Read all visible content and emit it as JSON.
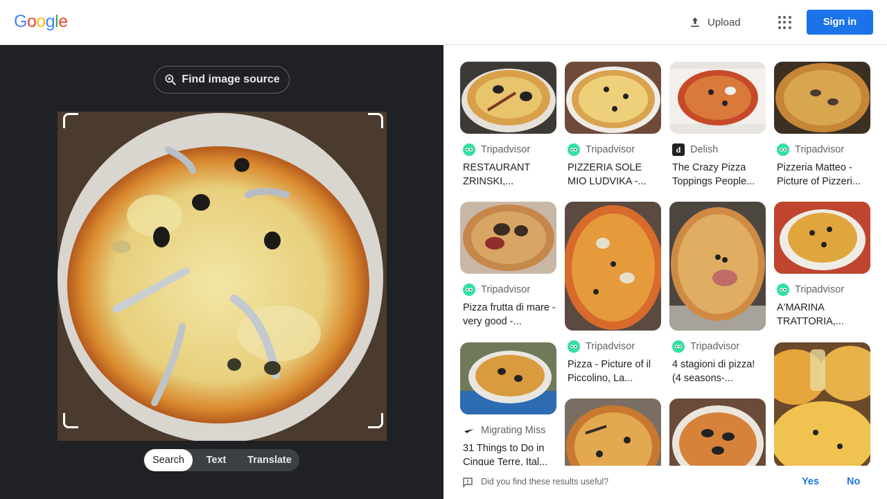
{
  "header": {
    "logo_letters": [
      "G",
      "o",
      "o",
      "g",
      "l",
      "e"
    ],
    "logo_colors": [
      "#4285F4",
      "#EA4335",
      "#FBBC05",
      "#4285F4",
      "#34A853",
      "#EA4335"
    ],
    "upload_label": "Upload",
    "upload_icon": "upload-icon",
    "apps_icon": "apps-grid-icon",
    "signin_label": "Sign in"
  },
  "lens": {
    "find_source_label": "Find image source",
    "find_source_icon": "lens-search-icon",
    "modes": [
      {
        "label": "Search",
        "active": true
      },
      {
        "label": "Text",
        "active": false
      },
      {
        "label": "Translate",
        "active": false
      }
    ]
  },
  "results": [
    {
      "source": "Tripadvisor",
      "icon": "tripadvisor-icon",
      "title": "RESTAURANT ZRINSKI,..."
    },
    {
      "source": "Tripadvisor",
      "icon": "tripadvisor-icon",
      "title": "PIZZERIA SOLE MIO LUDVIKA -..."
    },
    {
      "source": "Delish",
      "icon": "delish-icon",
      "title": "The Crazy Pizza Toppings People..."
    },
    {
      "source": "Tripadvisor",
      "icon": "tripadvisor-icon",
      "title": "Pizzeria Matteo - Picture of Pizzeri..."
    },
    {
      "source": "Tripadvisor",
      "icon": "tripadvisor-icon",
      "title": "Pizza frutta di mare - very good -..."
    },
    {
      "source": "Tripadvisor",
      "icon": "tripadvisor-icon",
      "title": "Pizza - Picture of il Piccolino, La..."
    },
    {
      "source": "Tripadvisor",
      "icon": "tripadvisor-icon",
      "title": "4 stagioni di pizza! (4 seasons-..."
    },
    {
      "source": "Tripadvisor",
      "icon": "tripadvisor-icon",
      "title": "A'MARINA TRATTORIA,..."
    },
    {
      "source": "Migrating Miss",
      "icon": "migrating-miss-icon",
      "title": "31 Things to Do in Cinque Terre, Ital..."
    }
  ],
  "feedback": {
    "question": "Did you find these results useful?",
    "yes_label": "Yes",
    "no_label": "No"
  },
  "colors": {
    "accent": "#1a73e8",
    "dark_panel": "#202124",
    "tripadvisor": "#34e0a1"
  }
}
